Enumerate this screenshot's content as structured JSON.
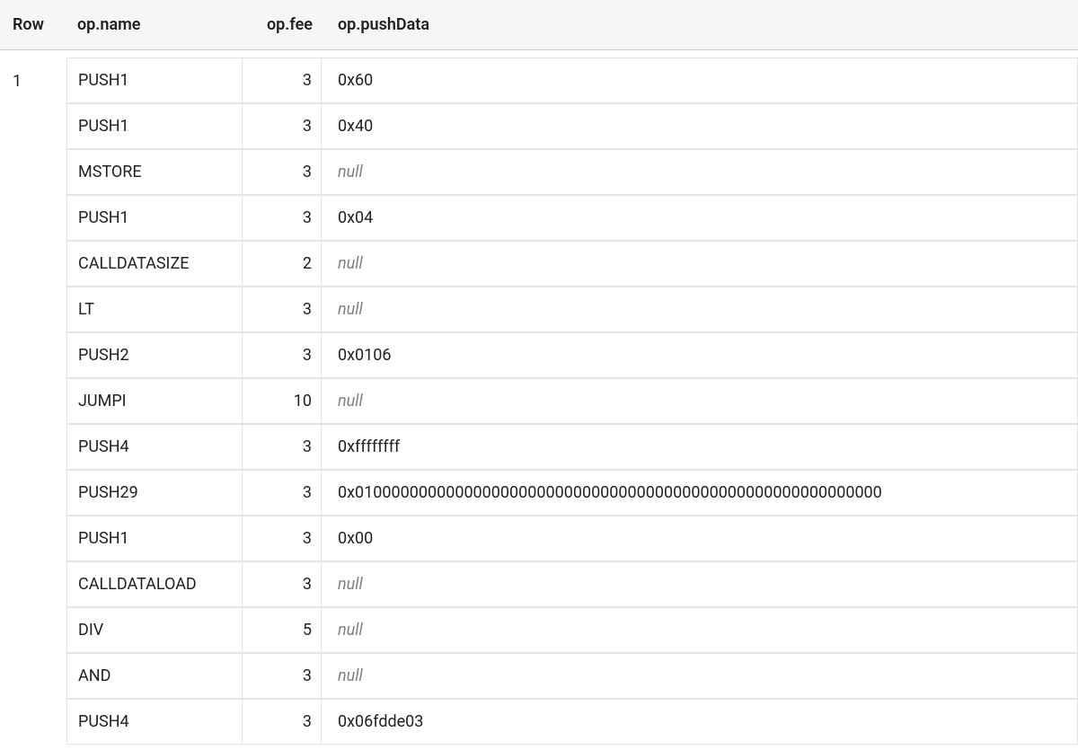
{
  "headers": {
    "row": "Row",
    "name": "op.name",
    "fee": "op.fee",
    "push": "op.pushData"
  },
  "nullLabel": "null",
  "rowNumber": "1",
  "ops": [
    {
      "name": "PUSH1",
      "fee": "3",
      "pushData": "0x60"
    },
    {
      "name": "PUSH1",
      "fee": "3",
      "pushData": "0x40"
    },
    {
      "name": "MSTORE",
      "fee": "3",
      "pushData": null
    },
    {
      "name": "PUSH1",
      "fee": "3",
      "pushData": "0x04"
    },
    {
      "name": "CALLDATASIZE",
      "fee": "2",
      "pushData": null
    },
    {
      "name": "LT",
      "fee": "3",
      "pushData": null
    },
    {
      "name": "PUSH2",
      "fee": "3",
      "pushData": "0x0106"
    },
    {
      "name": "JUMPI",
      "fee": "10",
      "pushData": null
    },
    {
      "name": "PUSH4",
      "fee": "3",
      "pushData": "0xffffffff"
    },
    {
      "name": "PUSH29",
      "fee": "3",
      "pushData": "0x0100000000000000000000000000000000000000000000000000000000"
    },
    {
      "name": "PUSH1",
      "fee": "3",
      "pushData": "0x00"
    },
    {
      "name": "CALLDATALOAD",
      "fee": "3",
      "pushData": null
    },
    {
      "name": "DIV",
      "fee": "5",
      "pushData": null
    },
    {
      "name": "AND",
      "fee": "3",
      "pushData": null
    },
    {
      "name": "PUSH4",
      "fee": "3",
      "pushData": "0x06fdde03"
    }
  ]
}
